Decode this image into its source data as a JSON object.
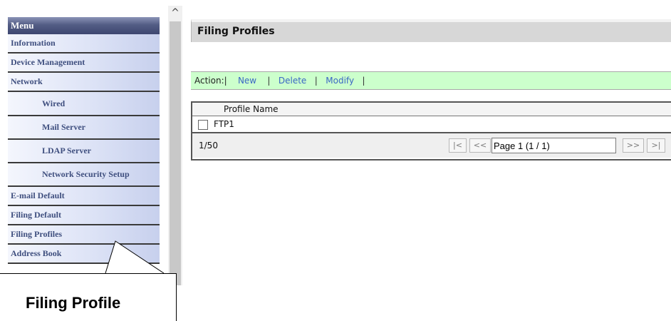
{
  "sidebar": {
    "header": "Menu",
    "items": [
      {
        "label": "Information",
        "level": "top"
      },
      {
        "label": "Device Management",
        "level": "top"
      },
      {
        "label": "Network",
        "level": "top"
      },
      {
        "label": "Wired",
        "level": "sub"
      },
      {
        "label": "Mail Server",
        "level": "sub"
      },
      {
        "label": "LDAP Server",
        "level": "sub"
      },
      {
        "label": "Network Security Setup",
        "level": "sub"
      },
      {
        "label": "E-mail Default",
        "level": "top"
      },
      {
        "label": "Filing Default",
        "level": "top"
      },
      {
        "label": "Filing Profiles",
        "level": "top"
      },
      {
        "label": "Address Book",
        "level": "top"
      }
    ]
  },
  "scrollbar": {
    "up_arrow": "^"
  },
  "callout": {
    "text": "Filing Profile"
  },
  "main": {
    "title": "Filing Profiles",
    "action_bar": {
      "label": "Action:|",
      "new_label": "New",
      "delete_label": "Delete",
      "modify_label": "Modify",
      "separator": "|"
    },
    "table": {
      "column_header": "Profile Name",
      "rows": [
        {
          "name": "FTP1",
          "checked": false
        }
      ]
    },
    "pager": {
      "count": "1/50",
      "first_label": "|<",
      "prev_label": "<<",
      "page_value": "Page 1 (1 / 1)",
      "next_label": ">>",
      "last_label": ">|"
    }
  }
}
